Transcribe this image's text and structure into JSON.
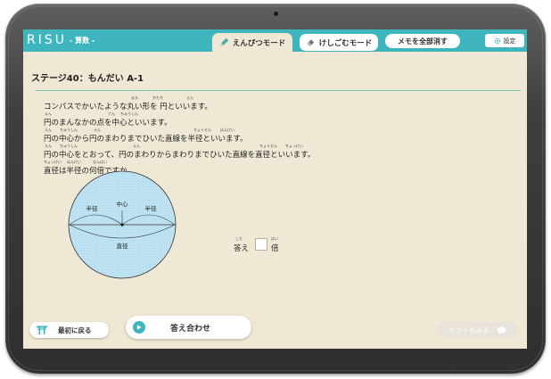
{
  "header": {
    "logo": "RISU",
    "subject": "- 算数 -",
    "pencil_mode_label": "えんぴつモード",
    "eraser_mode_label": "けしごむモード",
    "clear_memo_label": "メモを全部消す",
    "settings_label": "設定"
  },
  "stage": {
    "title": "ステージ40：もんだい A-1"
  },
  "problem": {
    "lines": [
      {
        "text": "コンパスでかいたような丸い形を 円といいます。",
        "ruby": [
          {
            "text": "まる",
            "offset": 98
          },
          {
            "text": "かたち",
            "offset": 122
          },
          {
            "text": "えん",
            "offset": 160
          }
        ]
      },
      {
        "text": "円のまんなかの点を中心といいます。",
        "ruby": [
          {
            "text": "えん",
            "offset": 1
          },
          {
            "text": "てん",
            "offset": 72
          },
          {
            "text": "ちゅうしん",
            "offset": 86
          }
        ]
      },
      {
        "text": "円の中心から円のまわりまでひいた直線を半径といいます。",
        "ruby": [
          {
            "text": "えん",
            "offset": 1
          },
          {
            "text": "ちゅうしん",
            "offset": 18
          },
          {
            "text": "えん",
            "offset": 56
          },
          {
            "text": "ちょくせん",
            "offset": 168
          },
          {
            "text": "はんけい",
            "offset": 198
          }
        ]
      },
      {
        "text": "円の中心をとおって、円のまわりからまわりまでひいた直線を直径といいます。",
        "ruby": [
          {
            "text": "えん",
            "offset": 1
          },
          {
            "text": "ちゅうしん",
            "offset": 18
          },
          {
            "text": "えん",
            "offset": 100
          },
          {
            "text": "ちょくせん",
            "offset": 242
          },
          {
            "text": "ちょっけい",
            "offset": 271
          }
        ]
      },
      {
        "text": "直径は半径の何倍ですか。",
        "ruby": [
          {
            "text": "ちょっけい",
            "offset": 0
          },
          {
            "text": "はんけい",
            "offset": 26
          },
          {
            "text": "なんばい",
            "offset": 55
          }
        ]
      }
    ]
  },
  "diagram": {
    "radius_left_label": "半径",
    "center_label": "中心",
    "radius_right_label": "半径",
    "diameter_label": "直径",
    "fill_color": "#bfe2f2",
    "stroke_color": "#333333"
  },
  "answer": {
    "prefix": "答え",
    "prefix_ruby": "こた",
    "suffix": "倍",
    "suffix_ruby": "ばい",
    "value": ""
  },
  "footer": {
    "back_label": "最初に戻る",
    "check_label": "答え合わせ",
    "hint_label": "ヒントをみる"
  },
  "colors": {
    "accent": "#3fb6bd",
    "screen_background": "#efe8d4",
    "frame": "#3a3a3a"
  }
}
